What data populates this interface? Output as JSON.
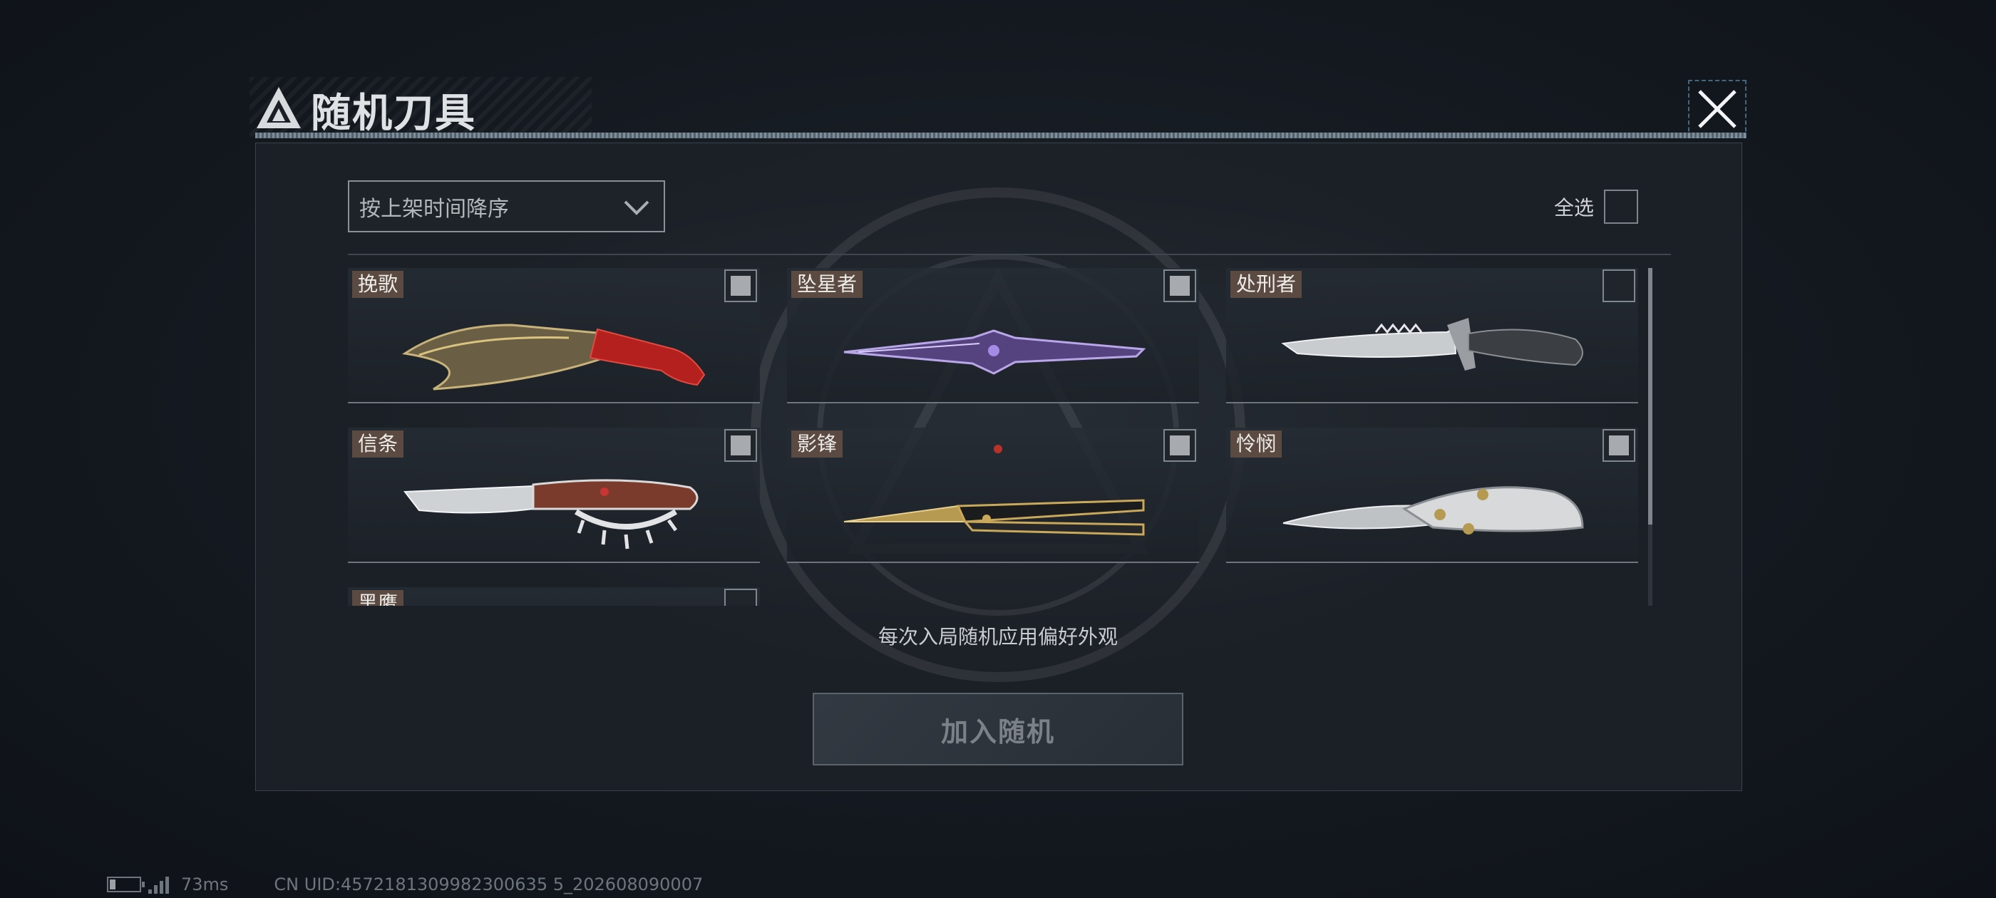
{
  "dialog": {
    "title": "随机刀具",
    "close_icon": "close-icon"
  },
  "sort": {
    "selected": "按上架时间降序",
    "icon": "chevron-down-icon"
  },
  "select_all": {
    "label": "全选",
    "checked": false
  },
  "knives": [
    {
      "name": "挽歌",
      "checked": false,
      "accent": "#c0262a"
    },
    {
      "name": "坠星者",
      "checked": false,
      "accent": "#7a62b8"
    },
    {
      "name": "处刑者",
      "checked": false,
      "accent": "#d8d8d8"
    },
    {
      "name": "信条",
      "checked": false,
      "accent": "#c94a4a"
    },
    {
      "name": "影锋",
      "checked": false,
      "accent": "#c9a85a"
    },
    {
      "name": "怜悯",
      "checked": false,
      "accent": "#d6d6d6"
    },
    {
      "name": "黑鹰",
      "checked": false,
      "accent": "#888888"
    }
  ],
  "hint": "每次入局随机应用偏好外观",
  "join_button": {
    "label": "加入随机",
    "enabled": false
  },
  "status": {
    "ping": "73ms",
    "uid": "CN UID:4572181309982300635 5_202608090007"
  }
}
